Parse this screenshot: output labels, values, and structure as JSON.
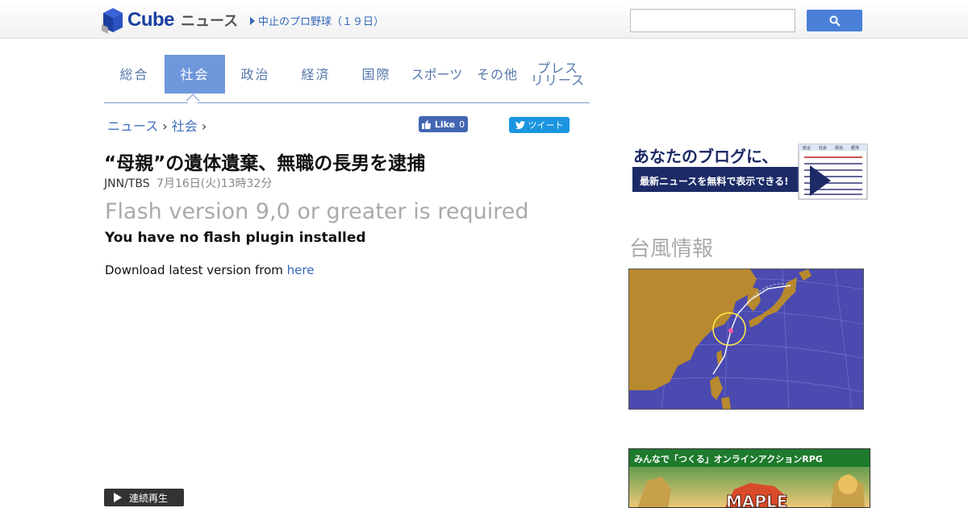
{
  "header": {
    "logo_text": "Cube",
    "logo_sub": "ニュース",
    "headline": "中止のプロ野球（１９日）",
    "search": {
      "placeholder": ""
    }
  },
  "tabs": [
    {
      "label": "総合",
      "active": false
    },
    {
      "label": "社会",
      "active": true
    },
    {
      "label": "政治",
      "active": false
    },
    {
      "label": "経済",
      "active": false
    },
    {
      "label": "国際",
      "active": false
    },
    {
      "label": "スポーツ",
      "active": false
    },
    {
      "label": "その他",
      "active": false
    },
    {
      "label": "プレス\nリリース",
      "active": false
    }
  ],
  "breadcrumb": {
    "root": "ニュース",
    "separator": "›",
    "current": "社会"
  },
  "social": {
    "fb_label": "Like",
    "fb_count": "0",
    "tw_label": "ツイート"
  },
  "article": {
    "title": "“母親”の遺体遺棄、無職の長男を逮捕",
    "source": "JNN/TBS",
    "date": "7月16日(火)13時32分"
  },
  "flash": {
    "heading": "Flash version 9,0 or greater is required",
    "subheading": "You have no flash plugin installed",
    "download_text": "Download latest version from ",
    "download_link": "here"
  },
  "player": {
    "continuous_play": "連続再生"
  },
  "sidebar": {
    "blog_banner": {
      "line1": "あなたのブログに、",
      "line2": "最新ニュースを無料で表示できる!",
      "mini_tabs": [
        "総合",
        "社会",
        "政治",
        "経済"
      ]
    },
    "typhoon_title": "台風情報",
    "game_banner": {
      "tagline": "みんなで「つくる」オンラインアクションRPG",
      "logo": "MAPLE"
    }
  },
  "colors": {
    "accent": "#6f98dc",
    "link": "#3366bb",
    "sea": "#4a4ab0",
    "land": "#b8892e"
  }
}
